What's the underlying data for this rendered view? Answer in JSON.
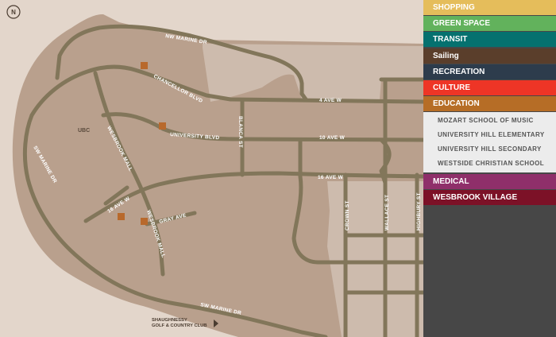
{
  "map": {
    "compass_label": "N",
    "place_label": "UBC",
    "roads": [
      {
        "name": "nw-marine-dr",
        "label": "NW MARINE DR"
      },
      {
        "name": "chancellor-blvd",
        "label": "CHANCELLOR BLVD"
      },
      {
        "name": "4-ave-w",
        "label": "4 AVE W"
      },
      {
        "name": "university-blvd",
        "label": "UNIVERSITY BLVD"
      },
      {
        "name": "10-ave-w",
        "label": "10 AVE W"
      },
      {
        "name": "blanca-st",
        "label": "BLANCA ST"
      },
      {
        "name": "wesbrook-mall-north",
        "label": "WESBROOK MALL"
      },
      {
        "name": "sw-marine-dr-west",
        "label": "SW MARINE DR"
      },
      {
        "name": "16-ave-w-east",
        "label": "16 AVE W"
      },
      {
        "name": "16-ave-w-west",
        "label": "16 AVE W"
      },
      {
        "name": "gray-ave",
        "label": "GRAY AVE"
      },
      {
        "name": "wesbrook-mall-south",
        "label": "WESBROOK MALL"
      },
      {
        "name": "crown-st",
        "label": "CROWN ST"
      },
      {
        "name": "wallace-st",
        "label": "WALLACE ST"
      },
      {
        "name": "highbury-st",
        "label": "HIGHBURY ST"
      },
      {
        "name": "sw-marine-dr-south",
        "label": "SW MARINE DR"
      }
    ],
    "golf_club_label": [
      "SHAUGHNESSY",
      "GOLF & COUNTRY CLUB"
    ],
    "marker_color": "#b8692c",
    "marker_count": 4
  },
  "sidebar": {
    "categories": [
      {
        "label": "SHOPPING",
        "color": "#e5bd5b"
      },
      {
        "label": "GREEN SPACE",
        "color": "#62b25c"
      },
      {
        "label": "TRANSIT",
        "color": "#05716f"
      },
      {
        "label": "Sailing",
        "color": "#5a3e2b"
      },
      {
        "label": "RECREATION",
        "color": "#2d3c4c"
      },
      {
        "label": "CULTURE",
        "color": "#ee3526"
      },
      {
        "label": "EDUCATION",
        "color": "#b66d26",
        "expanded": true,
        "items": [
          "MOZART SCHOOL OF MUSIC",
          "UNIVERSITY HILL ELEMENTARY",
          "UNIVERSITY HILL SECONDARY",
          "WESTSIDE CHRISTIAN SCHOOL"
        ]
      },
      {
        "label": "MEDICAL",
        "color": "#8f2f6a"
      },
      {
        "label": "WESBROOK VILLAGE",
        "color": "#7c1127"
      }
    ]
  }
}
